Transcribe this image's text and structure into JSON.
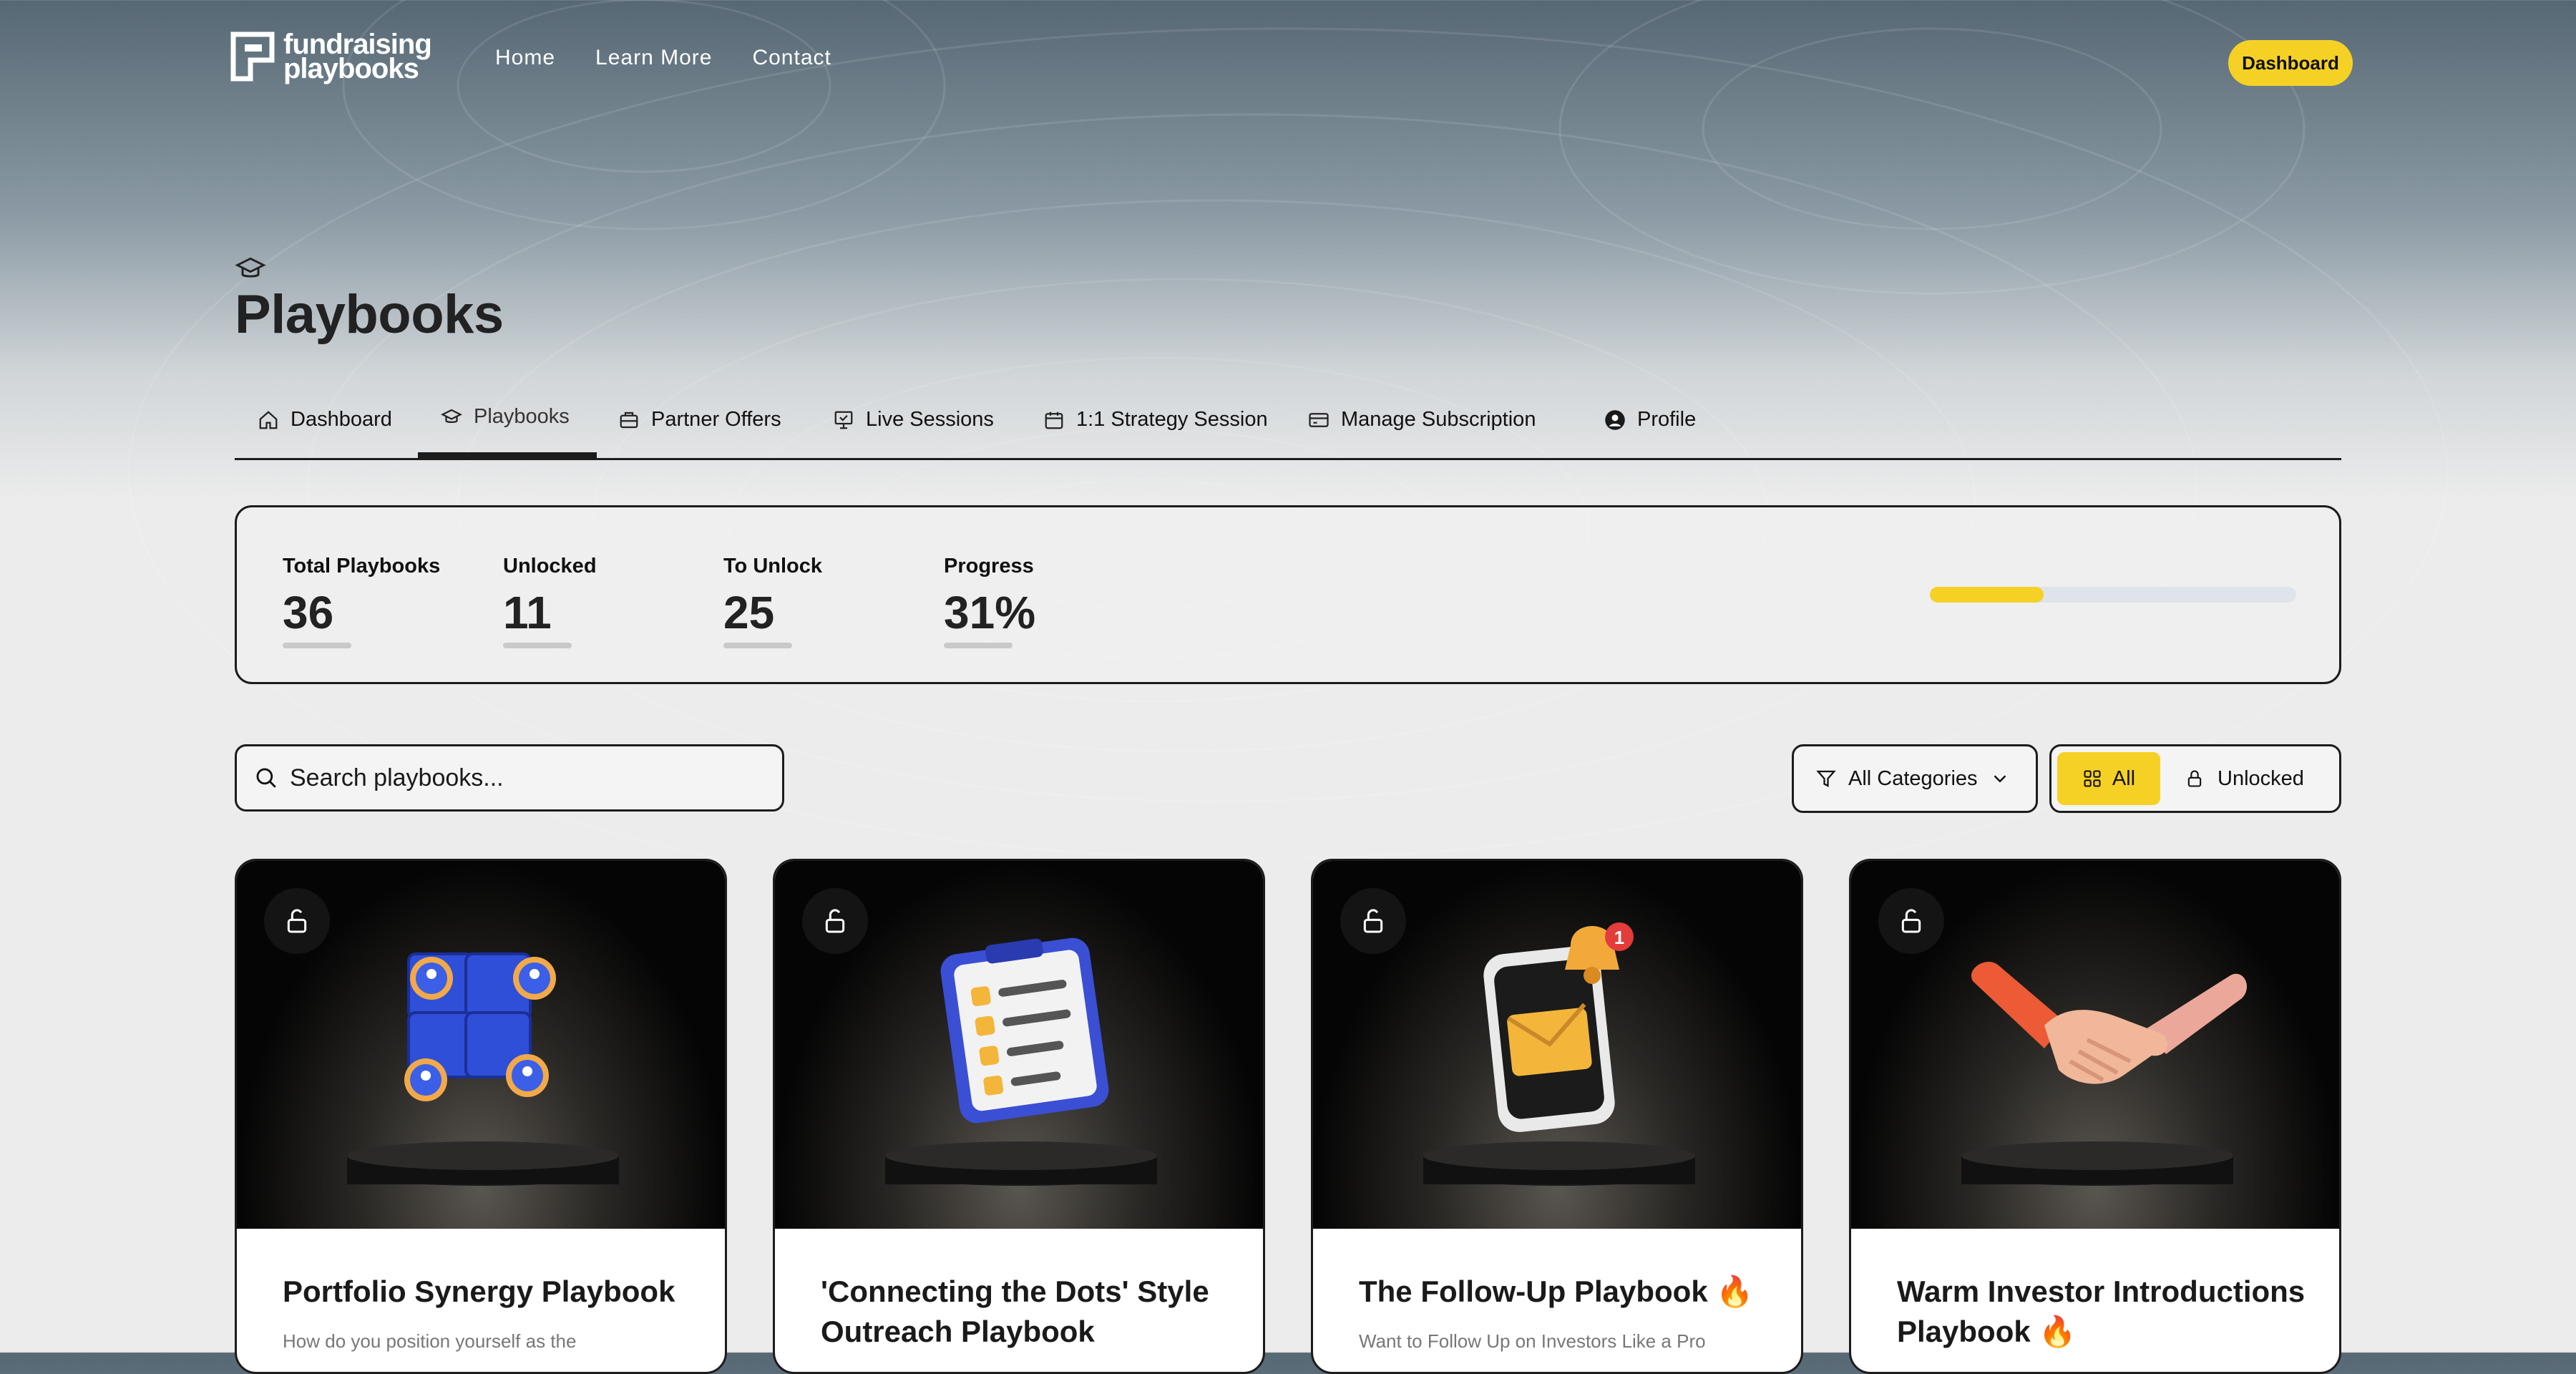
{
  "header": {
    "logo_line1": "fundraising",
    "logo_line2": "playbooks",
    "nav": [
      "Home",
      "Learn More",
      "Contact"
    ],
    "dashboard_button": "Dashboard"
  },
  "page": {
    "title": "Playbooks"
  },
  "tabs": [
    {
      "label": "Dashboard",
      "icon": "home-icon"
    },
    {
      "label": "Playbooks",
      "icon": "graduation-cap-icon",
      "active": true
    },
    {
      "label": "Partner Offers",
      "icon": "briefcase-icon"
    },
    {
      "label": "Live Sessions",
      "icon": "presentation-icon"
    },
    {
      "label": "1:1 Strategy Session",
      "icon": "calendar-icon"
    },
    {
      "label": "Manage Subscription",
      "icon": "credit-card-icon"
    },
    {
      "label": "Profile",
      "icon": "user-circle-icon"
    }
  ],
  "stats": {
    "total_label": "Total Playbooks",
    "total_value": "36",
    "unlocked_label": "Unlocked",
    "unlocked_value": "11",
    "tounlock_label": "To Unlock",
    "tounlock_value": "25",
    "progress_label": "Progress",
    "progress_value": "31%",
    "progress_fraction": 0.31
  },
  "search": {
    "placeholder": "Search playbooks..."
  },
  "filters": {
    "category": "All Categories",
    "seg_all": "All",
    "seg_unlocked": "Unlocked"
  },
  "colors": {
    "accent": "#f6d125",
    "ink": "#1c1c1c"
  },
  "cards": [
    {
      "title": "Portfolio Synergy Playbook",
      "desc": "How do you position yourself as the",
      "art": "puzzle-people-icon"
    },
    {
      "title": "'Connecting the Dots' Style Outreach Playbook",
      "desc": "",
      "art": "clipboard-checklist-icon"
    },
    {
      "title": "The Follow-Up Playbook 🔥",
      "desc": "Want to Follow Up on Investors Like a Pro",
      "art": "phone-notification-icon"
    },
    {
      "title": "Warm Investor Introductions Playbook 🔥",
      "desc": "",
      "art": "handshake-icon"
    }
  ]
}
